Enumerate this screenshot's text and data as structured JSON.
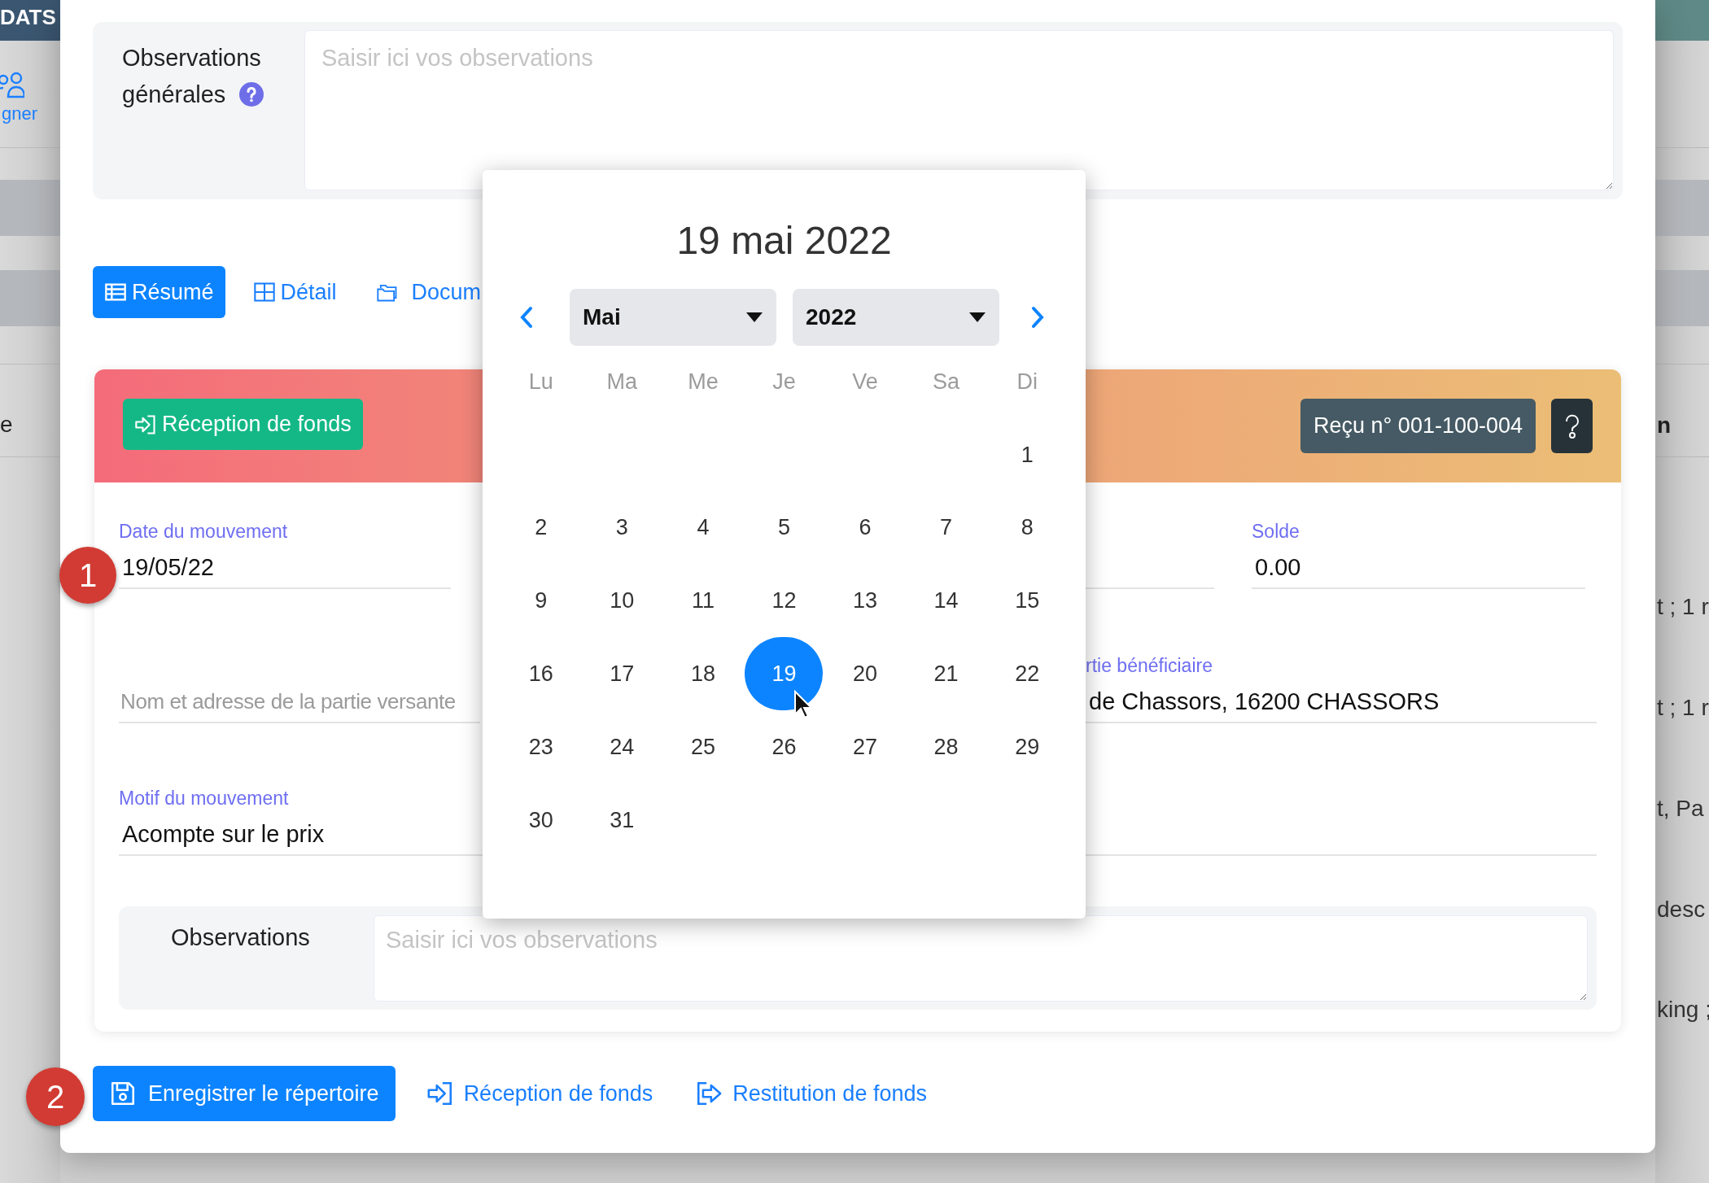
{
  "backdrop": {
    "left": {
      "header": "DATS",
      "link": "gner",
      "text": "e"
    },
    "right": {
      "heading": "n",
      "texts": [
        "t ; 1 r",
        "t ; 1 r",
        "t, Pa",
        "desc",
        "king ;"
      ]
    }
  },
  "general_observations": {
    "label": "Observations générales",
    "placeholder": "Saisir ici vos observations"
  },
  "tabs": [
    {
      "label": "Résumé",
      "selected": true
    },
    {
      "label": "Détail",
      "selected": false
    },
    {
      "label": "Docum",
      "selected": false
    }
  ],
  "card": {
    "type_button": "Réception de fonds",
    "receipt": "Reçu n° 001-100-004",
    "movement_date": {
      "label": "Date du mouvement",
      "value": "19/05/22"
    },
    "balance": {
      "label": "Solde",
      "value": "0.00"
    },
    "payer": {
      "placeholder": "Nom et adresse de la partie versante"
    },
    "beneficiary": {
      "label": "rtie bénéficiaire",
      "value": "de Chassors, 16200 CHASSORS"
    },
    "reason": {
      "label": "Motif du mouvement",
      "value": "Acompte sur le prix"
    },
    "observations": {
      "label": "Observations",
      "placeholder": "Saisir ici vos observations"
    }
  },
  "actions": [
    {
      "label": "Enregistrer le répertoire",
      "kind": "primary"
    },
    {
      "label": "Réception de fonds",
      "kind": "link"
    },
    {
      "label": "Restitution de fonds",
      "kind": "link"
    }
  ],
  "callouts": [
    "1",
    "2"
  ],
  "datepicker": {
    "title": "19 mai 2022",
    "month": "Mai",
    "year": "2022",
    "weekdays": [
      "Lu",
      "Ma",
      "Me",
      "Je",
      "Ve",
      "Sa",
      "Di"
    ],
    "weeks": [
      [
        {
          "label": "1",
          "selected": false
        }
      ],
      [
        {
          "label": "2",
          "selected": false
        },
        {
          "label": "3",
          "selected": false
        },
        {
          "label": "4",
          "selected": false
        },
        {
          "label": "5",
          "selected": false
        },
        {
          "label": "6",
          "selected": false
        },
        {
          "label": "7",
          "selected": false
        },
        {
          "label": "8",
          "selected": false
        }
      ],
      [
        {
          "label": "9",
          "selected": false
        },
        {
          "label": "10",
          "selected": false
        },
        {
          "label": "11",
          "selected": false
        },
        {
          "label": "12",
          "selected": false
        },
        {
          "label": "13",
          "selected": false
        },
        {
          "label": "14",
          "selected": false
        },
        {
          "label": "15",
          "selected": false
        }
      ],
      [
        {
          "label": "16",
          "selected": false
        },
        {
          "label": "17",
          "selected": false
        },
        {
          "label": "18",
          "selected": false
        },
        {
          "label": "19",
          "selected": true
        },
        {
          "label": "20",
          "selected": false
        },
        {
          "label": "21",
          "selected": false
        },
        {
          "label": "22",
          "selected": false
        }
      ],
      [
        {
          "label": "23",
          "selected": false
        },
        {
          "label": "24",
          "selected": false
        },
        {
          "label": "25",
          "selected": false
        },
        {
          "label": "26",
          "selected": false
        },
        {
          "label": "27",
          "selected": false
        },
        {
          "label": "28",
          "selected": false
        },
        {
          "label": "29",
          "selected": false
        }
      ],
      [
        {
          "label": "30",
          "selected": false
        },
        {
          "label": "31",
          "selected": false
        }
      ]
    ]
  }
}
